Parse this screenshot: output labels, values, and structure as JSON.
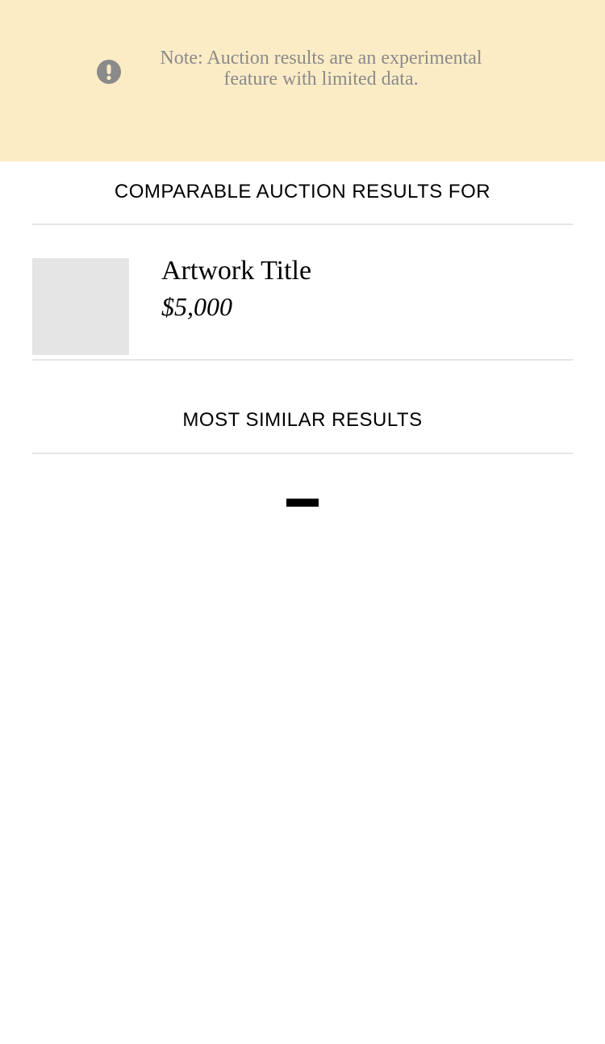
{
  "notice": {
    "icon": "exclamation-circle-icon",
    "text": "Note: Auction results are an experimental feature with limited data.",
    "background": "#fcecc6",
    "text_color": "#8a8a8a"
  },
  "comparable": {
    "heading": "COMPARABLE AUCTION RESULTS FOR",
    "artwork": {
      "title": "Artwork Title",
      "price": "$5,000"
    }
  },
  "similar": {
    "heading": "MOST SIMILAR RESULTS",
    "loading_indicator": "loading-spinner"
  }
}
